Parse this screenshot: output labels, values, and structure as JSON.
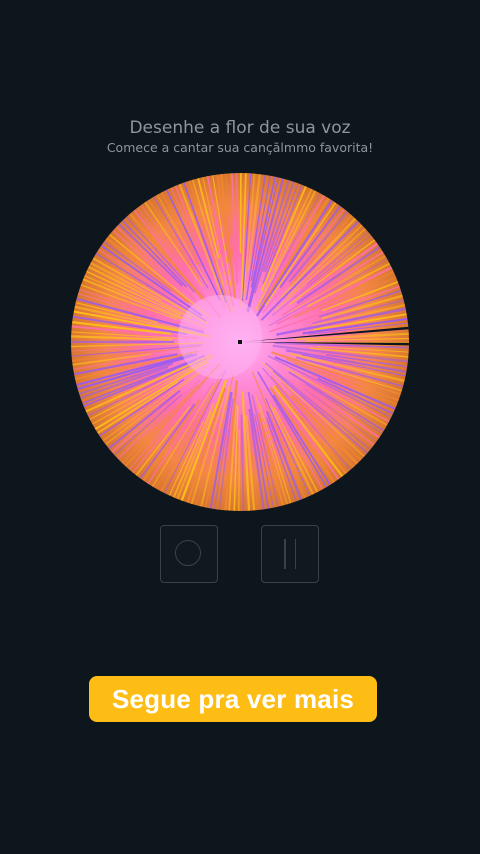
{
  "header": {
    "title": "Desenhe a flor de sua voz",
    "subtitle": "Comece a cantar sua cançãlmmo favorita!"
  },
  "flower": {
    "colors": {
      "center": "#ff9cf0",
      "mid": "#ff6fb0",
      "outer": "#ff8a3a",
      "yellow": "#ffc21a",
      "purple": "#9a5cf0",
      "orange": "#f28a2e"
    }
  },
  "controls": {
    "record_icon": "circle-record-icon",
    "pause_icon": "pause-icon"
  },
  "cta": {
    "label": "Segue pra ver mais",
    "color": "#fdbd14"
  },
  "background": "#0d161c"
}
